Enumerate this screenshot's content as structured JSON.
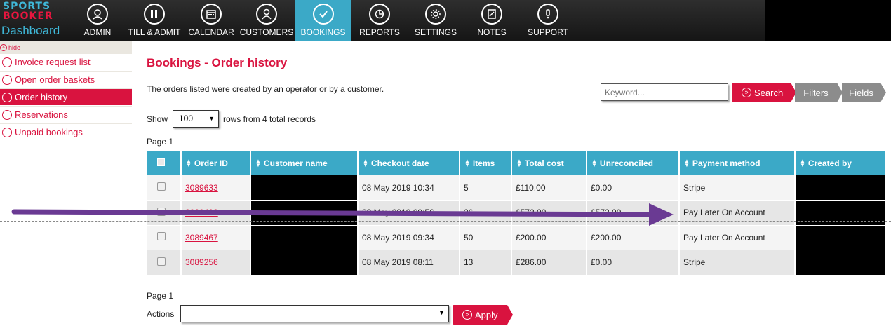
{
  "brand": {
    "line1": "SPORTS",
    "line2": "BOOKER",
    "section": "Dashboard"
  },
  "nav": [
    {
      "label": "ADMIN",
      "icon": "admin-icon"
    },
    {
      "label": "TILL & ADMIT",
      "icon": "till-icon"
    },
    {
      "label": "CALENDAR",
      "icon": "calendar-icon"
    },
    {
      "label": "CUSTOMERS",
      "icon": "customers-icon"
    },
    {
      "label": "BOOKINGS",
      "icon": "bookings-icon",
      "active": true
    },
    {
      "label": "REPORTS",
      "icon": "reports-icon"
    },
    {
      "label": "SETTINGS",
      "icon": "settings-icon"
    },
    {
      "label": "NOTES",
      "icon": "notes-icon"
    },
    {
      "label": "SUPPORT",
      "icon": "support-icon"
    }
  ],
  "sidebar": {
    "hide_label": "hide",
    "items": [
      {
        "label": "Invoice request list"
      },
      {
        "label": "Open order baskets"
      },
      {
        "label": "Order history",
        "active": true
      },
      {
        "label": "Reservations"
      },
      {
        "label": "Unpaid bookings"
      }
    ]
  },
  "main": {
    "title": "Bookings - Order history",
    "intro": "The orders listed were created by an operator or by a customer.",
    "search_placeholder": "Keyword...",
    "search_label": "Search",
    "filters_label": "Filters",
    "fields_label": "Fields",
    "show_label": "Show",
    "rows_value": "100",
    "rows_text": "rows from 4 total records",
    "page_label_top": "Page 1",
    "page_label_bottom": "Page 1",
    "actions_label": "Actions",
    "actions_value": "",
    "apply_label": "Apply"
  },
  "table": {
    "columns": [
      "Order ID",
      "Customer name",
      "Checkout date",
      "Items",
      "Total cost",
      "Unreconciled",
      "Payment method",
      "Created by"
    ],
    "rows": [
      {
        "order_id": "3089633",
        "customer": "",
        "date": "08 May 2019 10:34",
        "items": "5",
        "total": "£110.00",
        "unreconciled": "£0.00",
        "payment": "Stripe",
        "created_by": ""
      },
      {
        "order_id": "3089493",
        "customer": "",
        "date": "08 May 2019 09:56",
        "items": "26",
        "total": "£572.00",
        "unreconciled": "£572.00",
        "payment": "Pay Later On Account",
        "created_by": ""
      },
      {
        "order_id": "3089467",
        "customer": "",
        "date": "08 May 2019 09:34",
        "items": "50",
        "total": "£200.00",
        "unreconciled": "£200.00",
        "payment": "Pay Later On Account",
        "created_by": ""
      },
      {
        "order_id": "3089256",
        "customer": "",
        "date": "08 May 2019 08:11",
        "items": "13",
        "total": "£286.00",
        "unreconciled": "£0.00",
        "payment": "Stripe",
        "created_by": ""
      }
    ]
  },
  "colors": {
    "brand_red": "#d9133f",
    "accent_blue": "#3ba9c7",
    "arrow_purple": "#6a3a93"
  }
}
